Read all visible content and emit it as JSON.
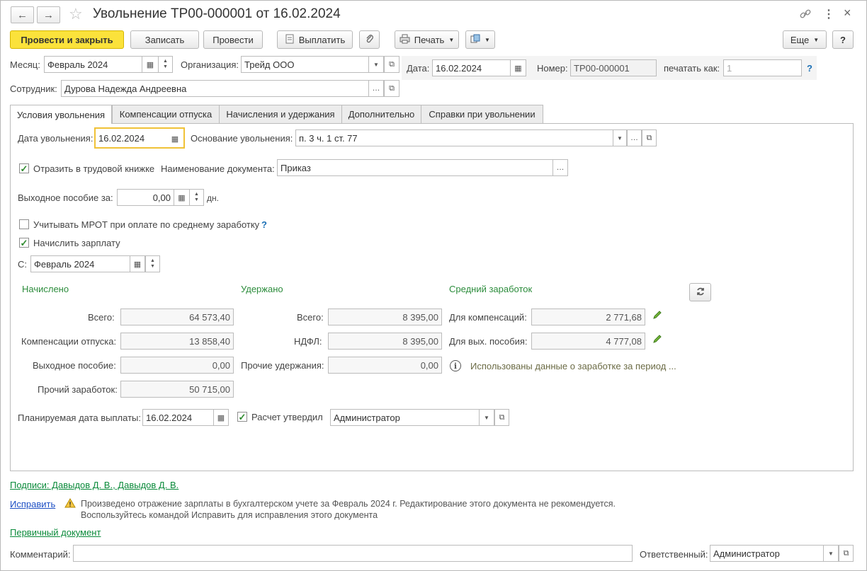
{
  "header": {
    "title": "Увольнение ТР00-000001 от 16.02.2024",
    "back_icon": "←",
    "forward_icon": "→",
    "star_icon": "☆",
    "link_icon": "🔗",
    "more_icon": "⋮",
    "close_icon": "×"
  },
  "toolbar": {
    "post_close": "Провести и закрыть",
    "save": "Записать",
    "post": "Провести",
    "pay": "Выплатить",
    "print": "Печать",
    "more": "Еще",
    "help": "?"
  },
  "fields": {
    "month_label": "Месяц:",
    "month_value": "Февраль 2024",
    "org_label": "Организация:",
    "org_value": "Трейд ООО",
    "date_label": "Дата:",
    "date_value": "16.02.2024",
    "number_label": "Номер:",
    "number_value": "ТР00-000001",
    "print_as_label": "печатать как:",
    "print_as_value": "1",
    "employee_label": "Сотрудник:",
    "employee_value": "Дурова Надежда Андреевна"
  },
  "tabs": [
    {
      "label": "Условия увольнения"
    },
    {
      "label": "Компенсации отпуска"
    },
    {
      "label": "Начисления и удержания"
    },
    {
      "label": "Дополнительно"
    },
    {
      "label": "Справки при увольнении"
    }
  ],
  "conditions": {
    "dismissal_date_label": "Дата увольнения:",
    "dismissal_date_value": "16.02.2024",
    "basis_label": "Основание увольнения:",
    "basis_value": "п. 3 ч. 1 ст. 77",
    "workbook_label": "Отразить в трудовой книжке",
    "doc_name_label": "Наименование документа:",
    "doc_name_value": "Приказ",
    "severance_label": "Выходное пособие за:",
    "severance_value": "0,00",
    "severance_unit": "дн.",
    "mrot_label": "Учитывать МРОТ при оплате по среднему заработку",
    "accrue_label": "Начислить зарплату",
    "from_label": "С:",
    "from_value": "Февраль 2024"
  },
  "accrued": {
    "title": "Начислено",
    "total_label": "Всего:",
    "total_value": "64 573,40",
    "vacation_label": "Компенсации отпуска:",
    "vacation_value": "13 858,40",
    "severance_label": "Выходное пособие:",
    "severance_value": "0,00",
    "other_label": "Прочий заработок:",
    "other_value": "50 715,00"
  },
  "withheld": {
    "title": "Удержано",
    "total_label": "Всего:",
    "total_value": "8 395,00",
    "ndfl_label": "НДФЛ:",
    "ndfl_value": "8 395,00",
    "other_label": "Прочие удержания:",
    "other_value": "0,00"
  },
  "average": {
    "title": "Средний заработок",
    "comp_label": "Для компенсаций:",
    "comp_value": "2 771,68",
    "sev_label": "Для вых. пособия:",
    "sev_value": "4 777,08",
    "info_text": "Использованы данные о заработке за период ..."
  },
  "payment": {
    "planned_label": "Планируемая дата выплаты:",
    "planned_value": "16.02.2024",
    "approved_label": "Расчет утвердил",
    "approved_value": "Администратор"
  },
  "footer": {
    "signatures": "Подписи: Давыдов Д. В., Давыдов Д. В.",
    "fix_link": "Исправить",
    "warning_line1": "Произведено отражение зарплаты в бухгалтерском учете за Февраль 2024 г. Редактирование этого документа не рекомендуется.",
    "warning_line2": "Воспользуйтесь командой Исправить для исправления этого документа",
    "primary_doc": "Первичный документ",
    "comment_label": "Комментарий:",
    "comment_value": "",
    "responsible_label": "Ответственный:",
    "responsible_value": "Администратор"
  },
  "colors": {
    "primary_button": "#fbe23b",
    "section_title": "#2c8c3c",
    "link": "#0a8a3a",
    "focus_border": "#f0c237"
  }
}
